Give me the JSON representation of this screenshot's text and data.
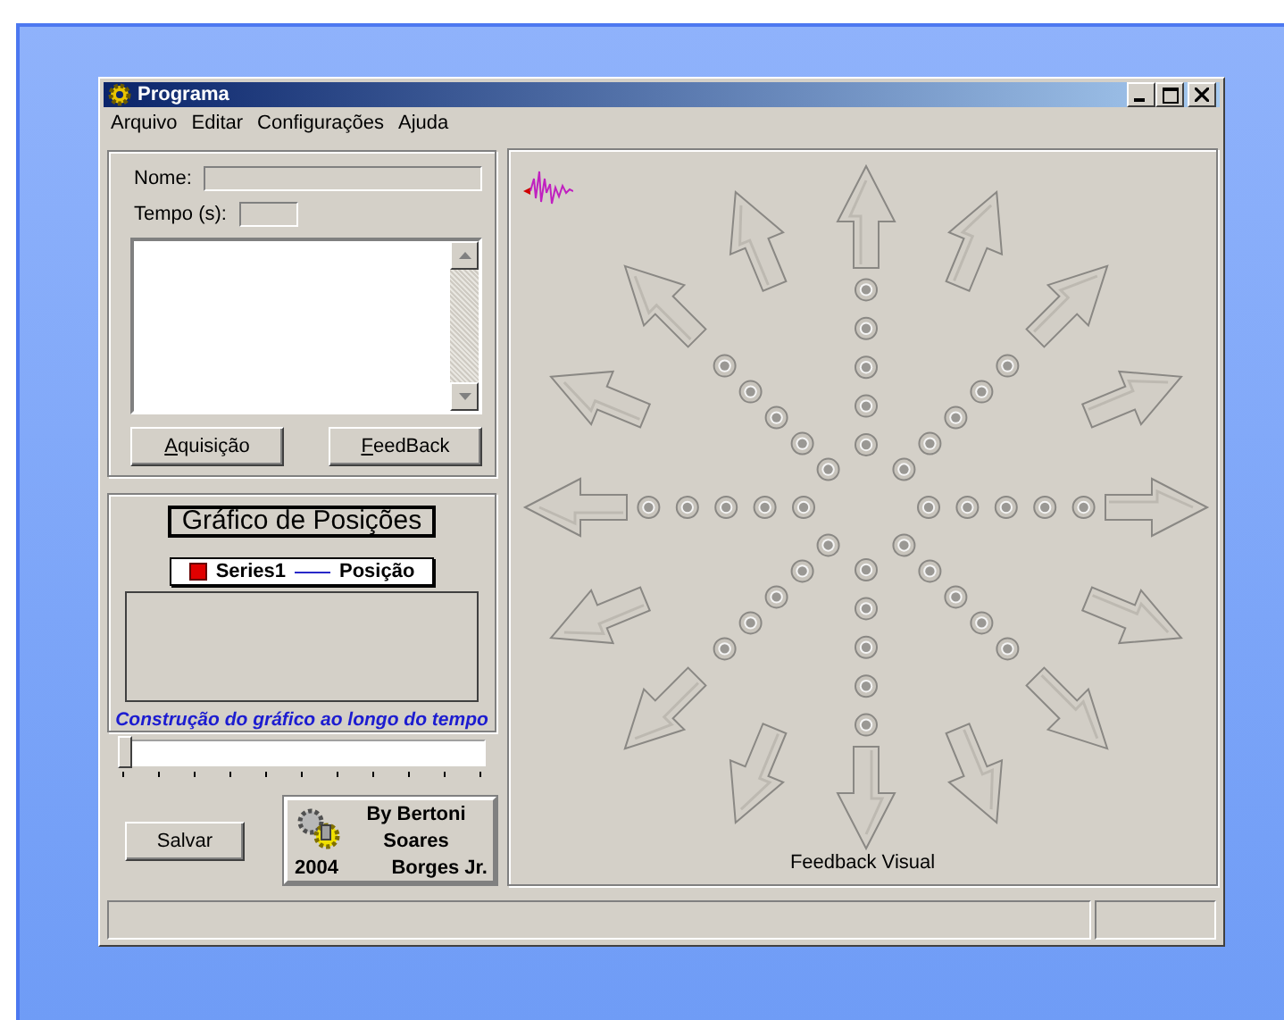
{
  "window": {
    "title": "Programa"
  },
  "menu": [
    "Arquivo",
    "Editar",
    "Configurações",
    "Ajuda"
  ],
  "fields": [
    {
      "label": "Nome:",
      "kind": "wide"
    },
    {
      "label": "Tempo (s):",
      "kind": "short"
    }
  ],
  "buttons": [
    {
      "label": "Aquisição",
      "mnemonic": true
    },
    {
      "label": "FeedBack",
      "mnemonic": true
    }
  ],
  "chart_panel": {
    "title": "Gráfico de Posições",
    "legend": [
      {
        "label": "Series1",
        "kind": "square",
        "color": "#e00000"
      },
      {
        "label": "Posição",
        "kind": "line",
        "color": "#2828c8"
      }
    ],
    "caption": "Construção do gráfico ao longo do tempo"
  },
  "slider": {
    "level": 0
  },
  "save_button": "Salvar",
  "credits": {
    "author": "By Bertoni",
    "middle": "Soares",
    "year": "2004",
    "last": "Borges Jr."
  },
  "feedback": {
    "label": "Feedback Visual"
  }
}
